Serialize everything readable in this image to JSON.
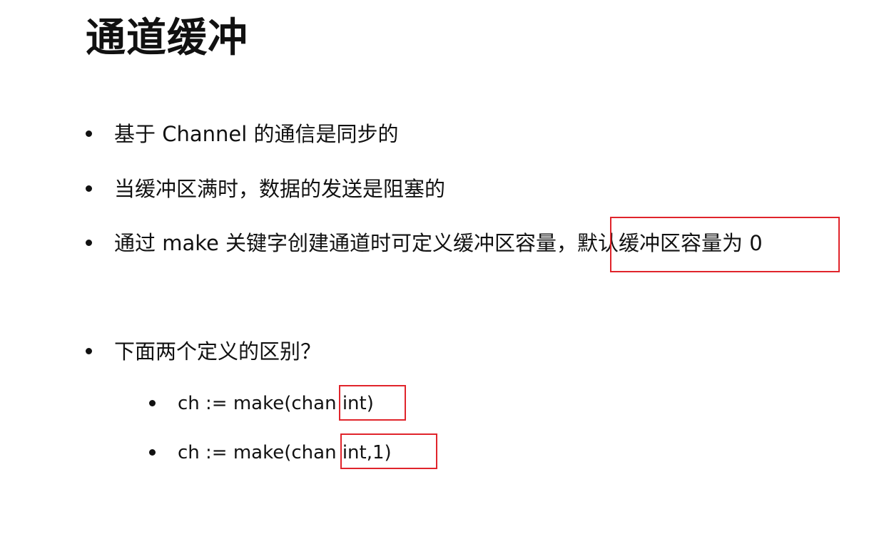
{
  "slide": {
    "title": "通道缓冲",
    "bullets": [
      {
        "text": "基于 Channel 的通信是同步的"
      },
      {
        "text": "当缓冲区满时，数据的发送是阻塞的"
      },
      {
        "text": "通过 make 关键字创建通道时可定义缓冲区容量，默认缓冲区容量为 0",
        "highlighted_part": "默认缓冲区容量为 0"
      },
      {
        "text": "下面两个定义的区别？"
      }
    ],
    "sub_bullets": [
      {
        "text": "ch := make(chan int)",
        "highlighted_part": "int)"
      },
      {
        "text": "ch := make(chan int,1)",
        "highlighted_part": "int,1)"
      }
    ]
  },
  "colors": {
    "text": "#111111",
    "highlight_border": "#e0242b",
    "background": "#ffffff"
  }
}
